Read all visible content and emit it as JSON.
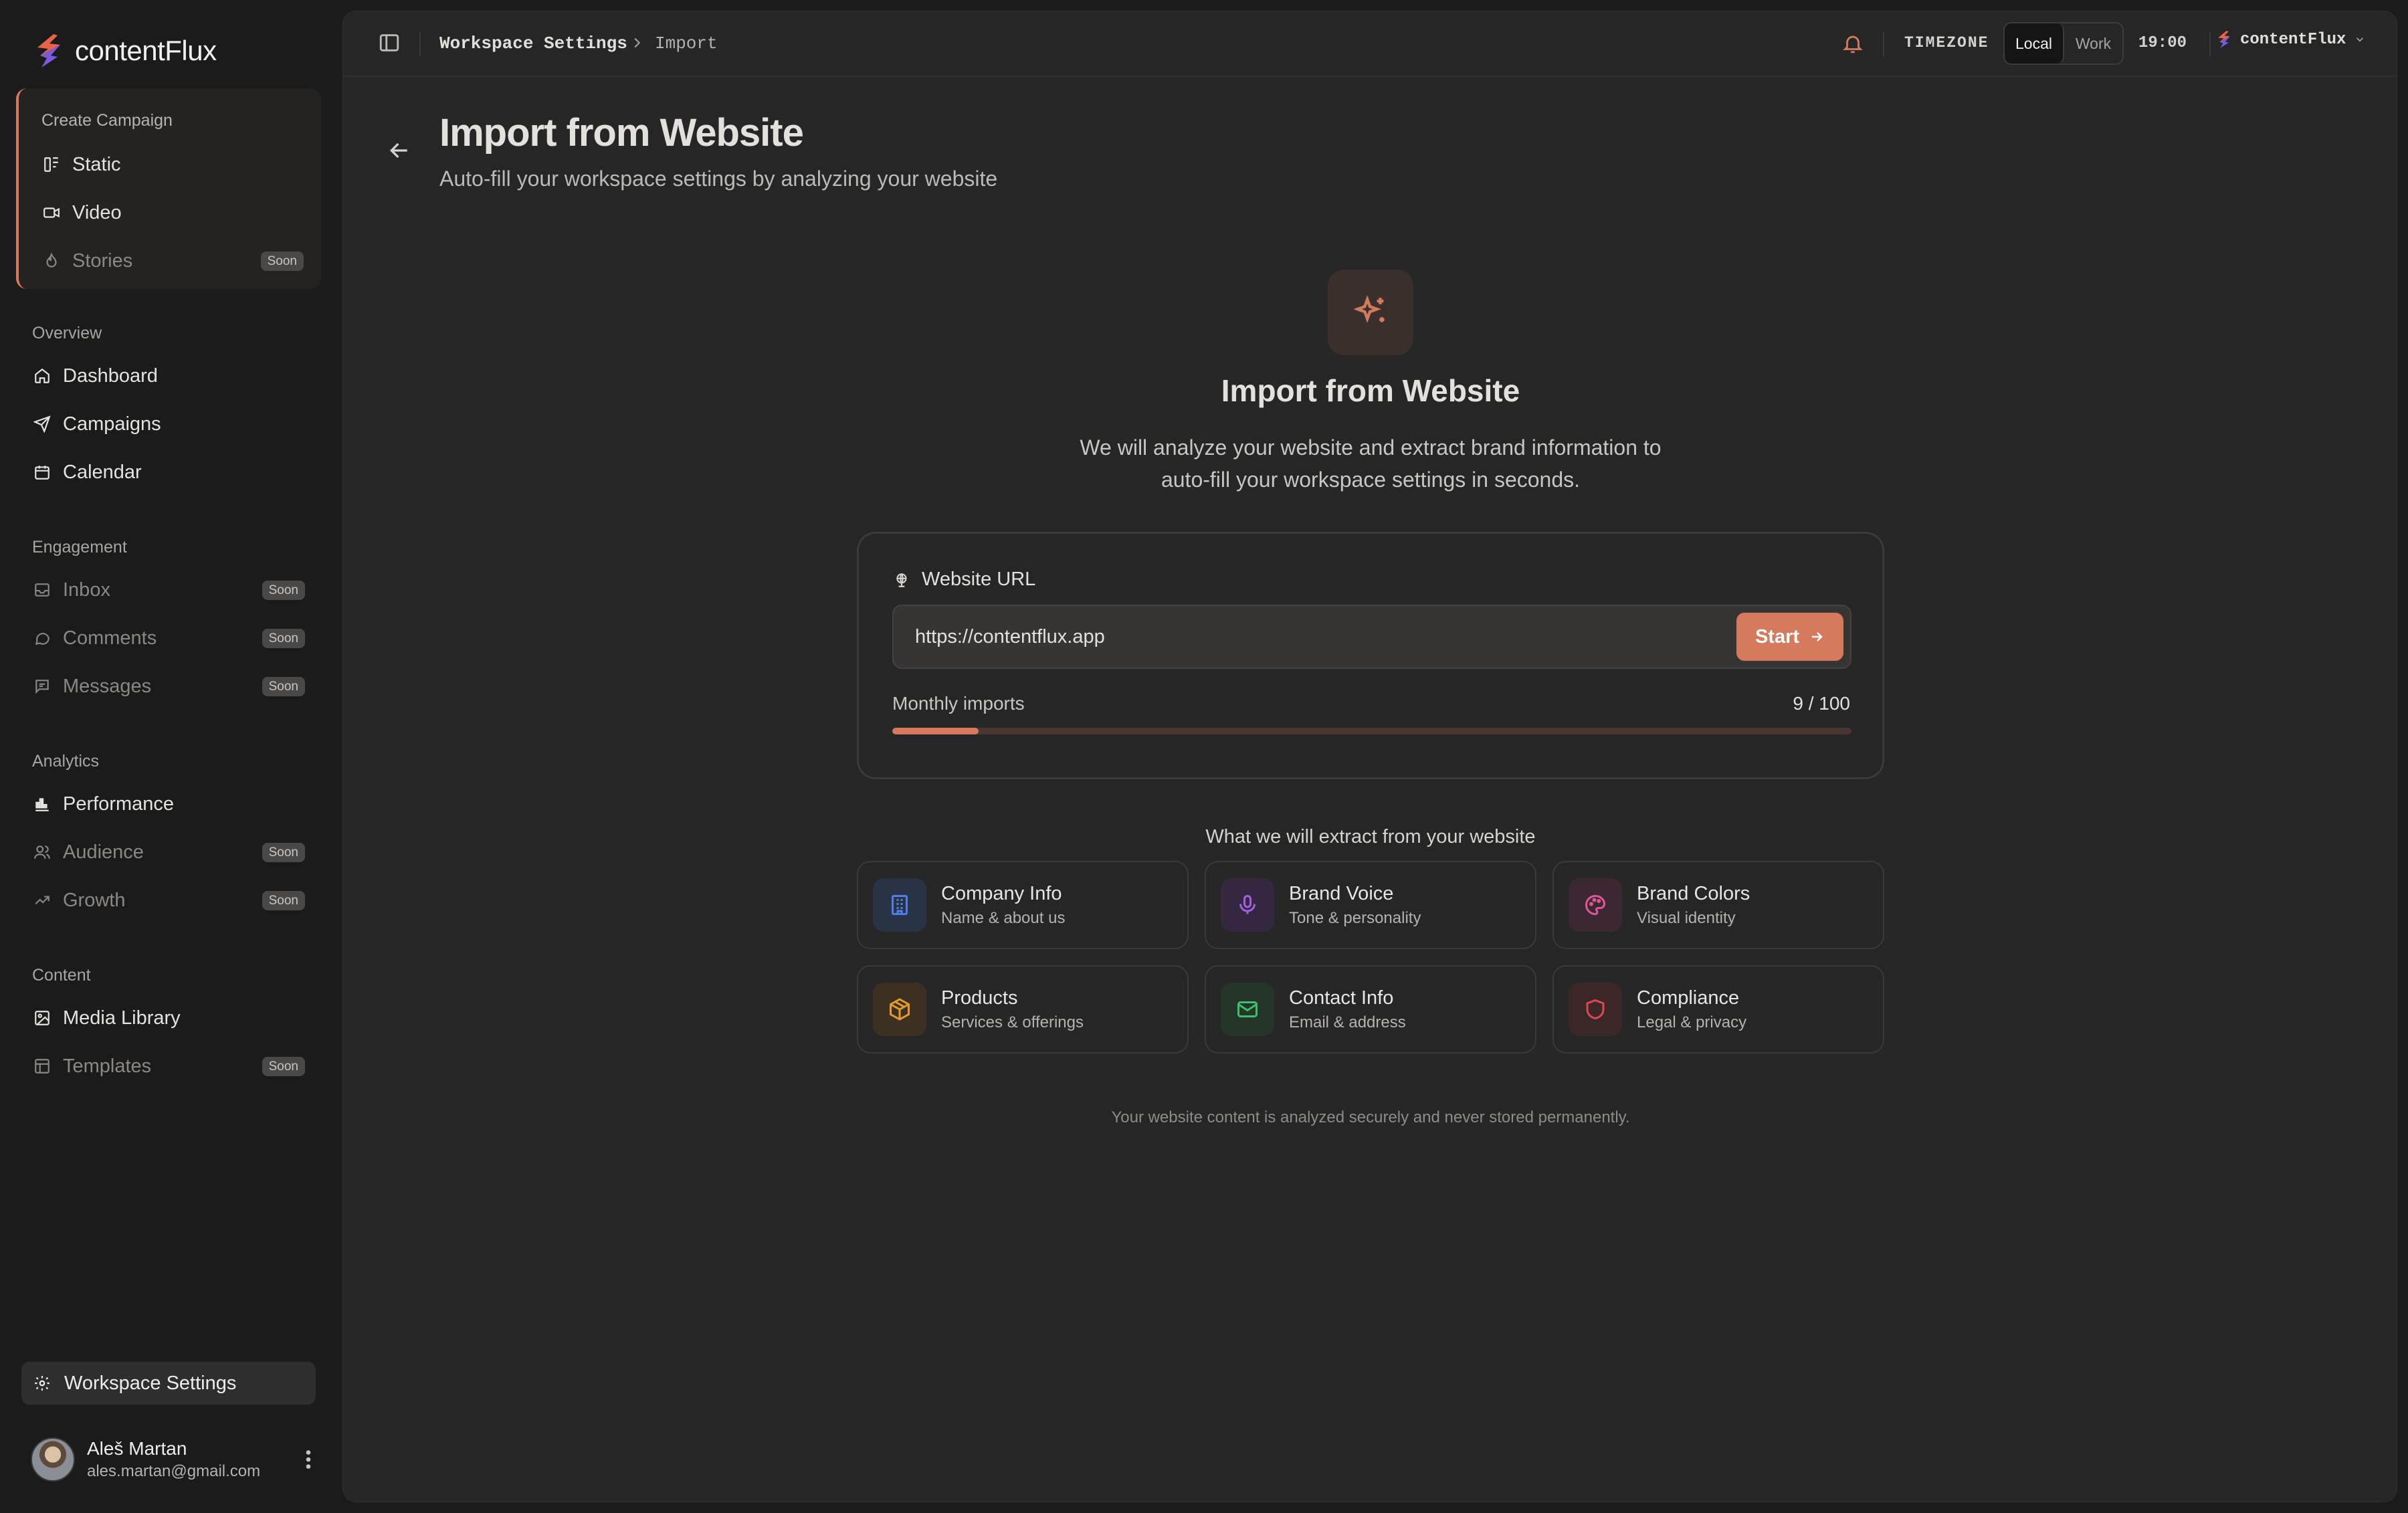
{
  "app": {
    "name": "contentFlux"
  },
  "sidebar": {
    "create_campaign": {
      "title": "Create Campaign",
      "items": [
        {
          "label": "Static",
          "icon": "layout-columns-icon"
        },
        {
          "label": "Video",
          "icon": "video-icon"
        },
        {
          "label": "Stories",
          "icon": "flame-icon",
          "badge": "Soon"
        }
      ]
    },
    "sections": [
      {
        "title": "Overview",
        "items": [
          {
            "label": "Dashboard",
            "icon": "home-icon"
          },
          {
            "label": "Campaigns",
            "icon": "send-icon"
          },
          {
            "label": "Calendar",
            "icon": "calendar-icon"
          }
        ]
      },
      {
        "title": "Engagement",
        "items": [
          {
            "label": "Inbox",
            "icon": "inbox-icon",
            "badge": "Soon"
          },
          {
            "label": "Comments",
            "icon": "comment-icon",
            "badge": "Soon"
          },
          {
            "label": "Messages",
            "icon": "message-icon",
            "badge": "Soon"
          }
        ]
      },
      {
        "title": "Analytics",
        "items": [
          {
            "label": "Performance",
            "icon": "bar-chart-icon"
          },
          {
            "label": "Audience",
            "icon": "users-icon",
            "badge": "Soon"
          },
          {
            "label": "Growth",
            "icon": "trending-up-icon",
            "badge": "Soon"
          }
        ]
      },
      {
        "title": "Content",
        "items": [
          {
            "label": "Media Library",
            "icon": "image-icon"
          },
          {
            "label": "Templates",
            "icon": "template-icon",
            "badge": "Soon"
          }
        ]
      }
    ],
    "workspace_settings": "Workspace Settings",
    "user": {
      "name": "Aleš Martan",
      "email": "ales.martan@gmail.com"
    }
  },
  "topbar": {
    "breadcrumb": [
      "Workspace Settings",
      "Import"
    ],
    "timezone_label": "TIMEZONE",
    "timezone_options": [
      "Local",
      "Work"
    ],
    "timezone_selected": "Local",
    "clock": "19:00",
    "workspace": "contentFlux"
  },
  "page": {
    "title": "Import from Website",
    "subtitle": "Auto-fill your workspace settings by analyzing your website"
  },
  "hero": {
    "title": "Import from Website",
    "description_line1": "We will analyze your website and extract brand information to",
    "description_line2": "auto-fill your workspace settings in seconds."
  },
  "url_card": {
    "label": "Website URL",
    "value": "https://contentflux.app",
    "start_label": "Start",
    "quota_label": "Monthly imports",
    "quota_value": "9 / 100",
    "quota_used": 9,
    "quota_total": 100
  },
  "extract": {
    "title": "What we will extract from your website",
    "items": [
      {
        "title": "Company Info",
        "subtitle": "Name & about us",
        "icon": "building-icon",
        "color": "#4f7fe6",
        "bg": "#283345"
      },
      {
        "title": "Brand Voice",
        "subtitle": "Tone & personality",
        "icon": "microphone-icon",
        "color": "#a45fe6",
        "bg": "#33283f"
      },
      {
        "title": "Brand Colors",
        "subtitle": "Visual identity",
        "icon": "palette-icon",
        "color": "#e2559a",
        "bg": "#3b2833"
      },
      {
        "title": "Products",
        "subtitle": "Services & offerings",
        "icon": "package-icon",
        "color": "#e69a2e",
        "bg": "#3b3022"
      },
      {
        "title": "Contact Info",
        "subtitle": "Email & address",
        "icon": "mail-icon",
        "color": "#3fbf6a",
        "bg": "#24352a"
      },
      {
        "title": "Compliance",
        "subtitle": "Legal & privacy",
        "icon": "shield-icon",
        "color": "#e0484f",
        "bg": "#3b2628"
      }
    ]
  },
  "footnote": "Your website content is analyzed securely and never stored permanently.",
  "colors": {
    "accent": "#d57a5c",
    "background": "#1b1b1b",
    "panel": "#262626"
  }
}
